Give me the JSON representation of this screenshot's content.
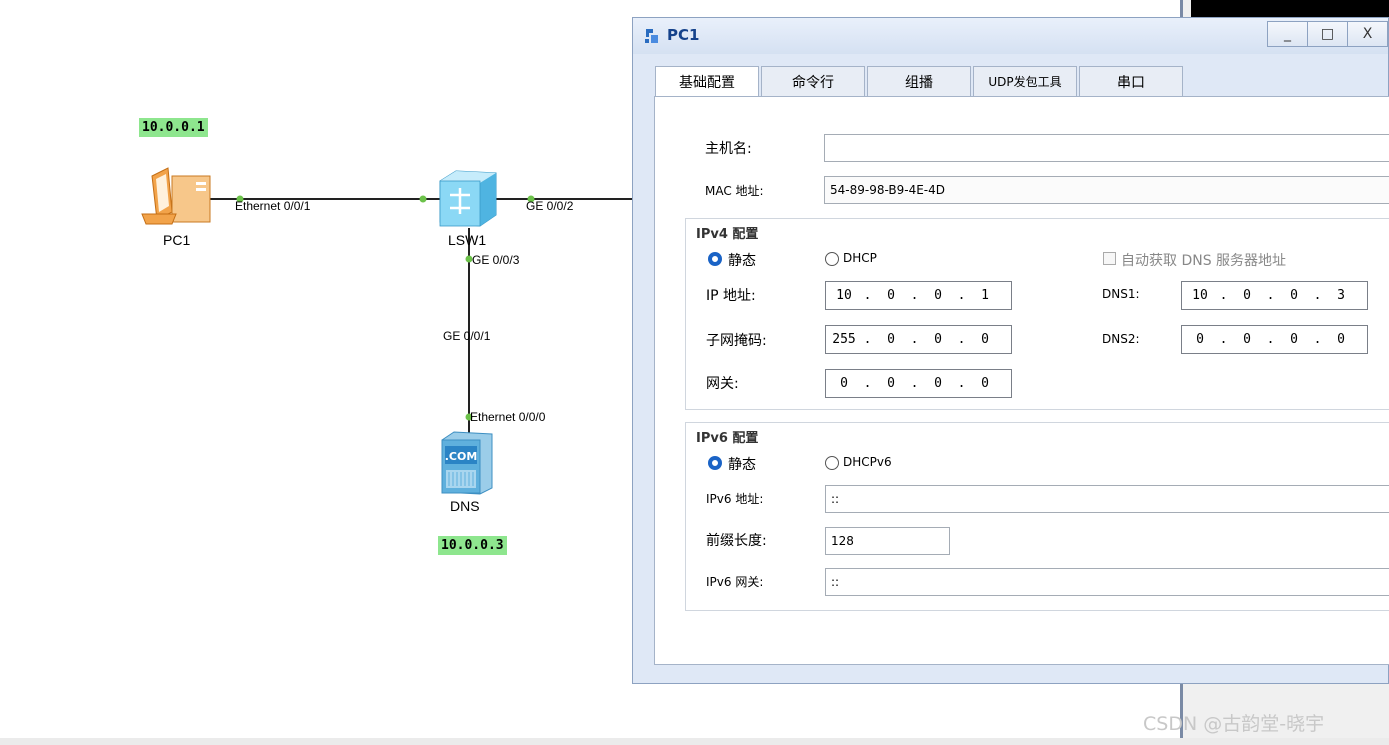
{
  "topology": {
    "ip_labels": {
      "pc1": "10.0.0.1",
      "dns": "10.0.0.3"
    },
    "nodes": {
      "pc1": "PC1",
      "lsw1": "LSW1",
      "dns": "DNS",
      "dns_icon_text": ".COM"
    },
    "ports": {
      "pc1_eth": "Ethernet 0/0/1",
      "lsw1_ge2": "GE 0/0/2",
      "lsw1_ge3": "GE 0/0/3",
      "lsw1_ge1": "GE 0/0/1",
      "dns_eth": "Ethernet 0/0/0"
    }
  },
  "dialog": {
    "title": "PC1",
    "window_buttons": {
      "minimize": "_",
      "maximize": "□",
      "close": "X"
    },
    "tabs": [
      "基础配置",
      "命令行",
      "组播",
      "UDP发包工具",
      "串口"
    ],
    "hostname": {
      "label": "主机名:",
      "value": ""
    },
    "mac": {
      "label": "MAC 地址:",
      "value": "54-89-98-B9-4E-4D"
    },
    "ipv4": {
      "section_title": "IPv4 配置",
      "static_label": "静态",
      "dhcp_label": "DHCP",
      "auto_dns_label": "自动获取 DNS 服务器地址",
      "ip_label": "IP 地址:",
      "ip": [
        "10",
        "0",
        "0",
        "1"
      ],
      "mask_label": "子网掩码:",
      "mask": [
        "255",
        "0",
        "0",
        "0"
      ],
      "gateway_label": "网关:",
      "gateway": [
        "0",
        "0",
        "0",
        "0"
      ],
      "dns1_label": "DNS1:",
      "dns1": [
        "10",
        "0",
        "0",
        "3"
      ],
      "dns2_label": "DNS2:",
      "dns2": [
        "0",
        "0",
        "0",
        "0"
      ]
    },
    "ipv6": {
      "section_title": "IPv6 配置",
      "static_label": "静态",
      "dhcp_label": "DHCPv6",
      "addr_label": "IPv6 地址:",
      "addr": "::",
      "prefix_label": "前缀长度:",
      "prefix": "128",
      "gateway_label": "IPv6 网关:",
      "gateway": "::"
    }
  },
  "watermark": "CSDN @古韵堂-晓宇"
}
